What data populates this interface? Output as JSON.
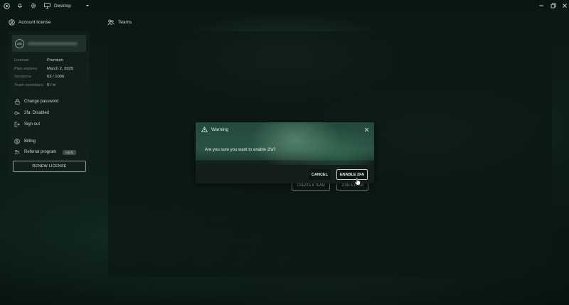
{
  "topbar": {
    "workspace_label": "Desktop",
    "icons": [
      "app-logo-icon",
      "bell-icon",
      "gear-icon",
      "monitor-icon",
      "chevron-down-icon"
    ],
    "window_controls": [
      "minimize",
      "maximize",
      "close"
    ]
  },
  "sidebar": {
    "title": "Account license",
    "avatar_initials": "ZIS",
    "info": [
      {
        "key": "License:",
        "value": "Premium"
      },
      {
        "key": "Plan expires:",
        "value": "March 2, 2025"
      },
      {
        "key": "Sessions:",
        "value": "63 / 1000"
      },
      {
        "key": "Team members:",
        "value": "0 / ∞"
      }
    ],
    "menu": [
      {
        "label": "Change password",
        "icon": "lock-icon"
      },
      {
        "label": "2fa: Disabled",
        "icon": "key-icon"
      },
      {
        "label": "Sign out",
        "icon": "logout-icon"
      },
      {
        "label": "Billing",
        "icon": "dollar-icon"
      },
      {
        "label": "Referral program",
        "icon": "people-icon",
        "badge": "NEW"
      }
    ],
    "renew_label": "RENEW LICENSE"
  },
  "main": {
    "title": "Teams",
    "create_team_label": "CREATE A TEAM",
    "join_team_label": "JOIN A TEAM"
  },
  "dialog": {
    "title": "Warning",
    "message": "Are you sure you want to enable 2fa?",
    "cancel_label": "CANCEL",
    "confirm_label": "ENABLE 2FA"
  },
  "colors": {
    "background": "#0f221c",
    "panel": "#12201c",
    "dialog_footer": "#141e1b",
    "text": "#d9e4df",
    "muted": "#72807b"
  }
}
